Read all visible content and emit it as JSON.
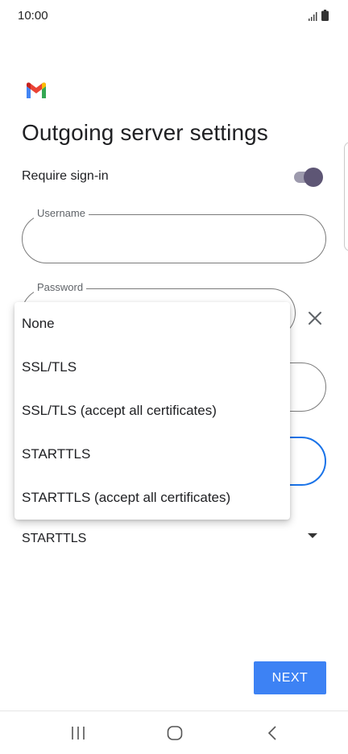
{
  "status_bar": {
    "time": "10:00",
    "icons": [
      "signal-icon",
      "battery-icon"
    ]
  },
  "app": {
    "logo": "gmail-logo",
    "title": "Outgoing server settings"
  },
  "form": {
    "require_signin": {
      "label": "Require sign-in",
      "enabled": true
    },
    "username": {
      "label": "Username",
      "value": ""
    },
    "password": {
      "label": "Password",
      "value": ""
    },
    "security_type": {
      "value": "STARTTLS"
    }
  },
  "dropdown": {
    "options": [
      "None",
      "SSL/TLS",
      "SSL/TLS (accept all certificates)",
      "STARTTLS",
      "STARTTLS (accept all certificates)"
    ]
  },
  "actions": {
    "next_label": "NEXT"
  },
  "navigation": {
    "buttons": [
      "recent-apps-icon",
      "home-icon",
      "back-icon"
    ]
  },
  "colors": {
    "accent": "#3d82f4",
    "focus_border": "#1a73e8",
    "toggle_thumb": "#5e5675",
    "toggle_track": "#9d9aad"
  }
}
